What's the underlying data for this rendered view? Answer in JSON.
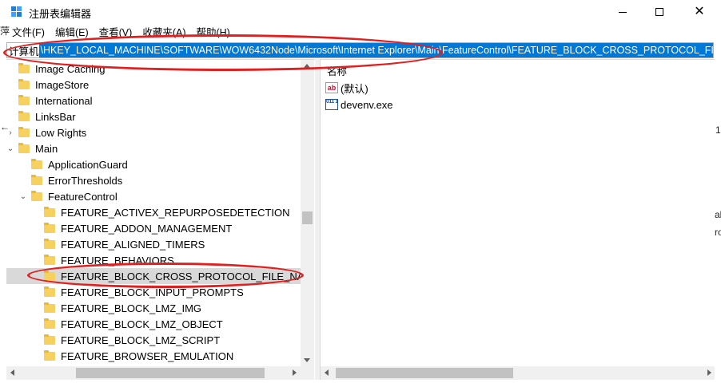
{
  "window": {
    "title": "注册表编辑器",
    "controls": {
      "minimize": "—",
      "maximize": "☐",
      "close": "✕"
    }
  },
  "menu": [
    "文件(F)",
    "编辑(E)",
    "查看(V)",
    "收藏夹(A)",
    "帮助(H)"
  ],
  "address": {
    "label": "计算机",
    "path": "\\HKEY_LOCAL_MACHINE\\SOFTWARE\\WOW6432Node\\Microsoft\\Internet Explorer\\Main\\FeatureControl\\FEATURE_BLOCK_CROSS_PROTOCOL_FILE_NAVIGATION"
  },
  "tree": {
    "items": [
      {
        "label": "Image Caching",
        "expander": ""
      },
      {
        "label": "ImageStore",
        "expander": ""
      },
      {
        "label": "International",
        "expander": ""
      },
      {
        "label": "LinksBar",
        "expander": ""
      },
      {
        "label": "Low Rights",
        "expander": "›"
      },
      {
        "label": "Main",
        "expander": "⌄"
      },
      {
        "label": "ApplicationGuard",
        "expander": ""
      },
      {
        "label": "ErrorThresholds",
        "expander": ""
      },
      {
        "label": "FeatureControl",
        "expander": "⌄"
      },
      {
        "label": "FEATURE_ACTIVEX_REPURPOSEDETECTION",
        "expander": ""
      },
      {
        "label": "FEATURE_ADDON_MANAGEMENT",
        "expander": ""
      },
      {
        "label": "FEATURE_ALIGNED_TIMERS",
        "expander": ""
      },
      {
        "label": "FEATURE_BEHAVIORS",
        "expander": ""
      },
      {
        "label": "FEATURE_BLOCK_CROSS_PROTOCOL_FILE_NAVIGATI",
        "expander": "",
        "selected": true
      },
      {
        "label": "FEATURE_BLOCK_INPUT_PROMPTS",
        "expander": ""
      },
      {
        "label": "FEATURE_BLOCK_LMZ_IMG",
        "expander": ""
      },
      {
        "label": "FEATURE_BLOCK_LMZ_OBJECT",
        "expander": ""
      },
      {
        "label": "FEATURE_BLOCK_LMZ_SCRIPT",
        "expander": ""
      },
      {
        "label": "FEATURE_BROWSER_EMULATION",
        "expander": ""
      }
    ]
  },
  "values": {
    "column_name": "名称",
    "rows": [
      {
        "icon": "ab",
        "name": "(默认)"
      },
      {
        "icon": "011\n110",
        "name": "devenv.exe"
      }
    ]
  },
  "background_edges": {
    "left_glyph": "←",
    "left_char": "萍",
    "right_1": "1",
    "right_2": "al",
    "right_3": "ro"
  },
  "colors": {
    "selection": "#0078d7",
    "annotation": "#e02020",
    "folder": "#f7d160"
  }
}
